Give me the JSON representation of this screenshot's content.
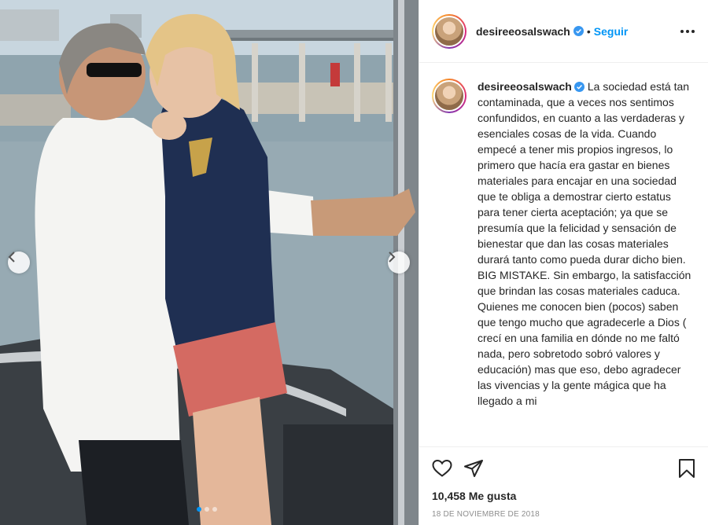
{
  "post": {
    "username": "desireeosalswach",
    "separator": "•",
    "follow_label": "Seguir",
    "caption": "La sociedad está tan contaminada, que a veces nos sentimos confundidos, en cuanto a las verdaderas y esenciales cosas de la vida. Cuando empecé a tener mis propios ingresos, lo primero que hacía era gastar en bienes materiales para encajar en una sociedad que te obliga a demostrar cierto estatus para tener cierta aceptación; ya que se presumía que la felicidad y sensación de bienestar que dan las cosas materiales durará tanto como pueda durar dicho bien. BIG MISTAKE. Sin embargo, la satisfacción que brindan las cosas materiales caduca. Quienes me conocen bien (pocos) saben que tengo mucho que agradecerle a Dios ( crecí en una familia en dónde no me faltó nada, pero sobretodo sobró valores y educación) mas que eso, debo agradecer las vivencias y la gente mágica que ha llegado a mi",
    "likes": "10,458 Me gusta",
    "date": "18 DE NOVIEMBRE DE 2018"
  },
  "carousel": {
    "slide_count": 3,
    "active_slide": 1
  },
  "colors": {
    "accent": "#0095f6",
    "text": "#262626",
    "muted": "#8e8e8e",
    "border": "#efefef"
  },
  "icons": [
    "verified-icon",
    "more-options-icon",
    "heart-icon",
    "share-icon",
    "bookmark-icon",
    "chevron-left-icon",
    "chevron-right-icon"
  ]
}
